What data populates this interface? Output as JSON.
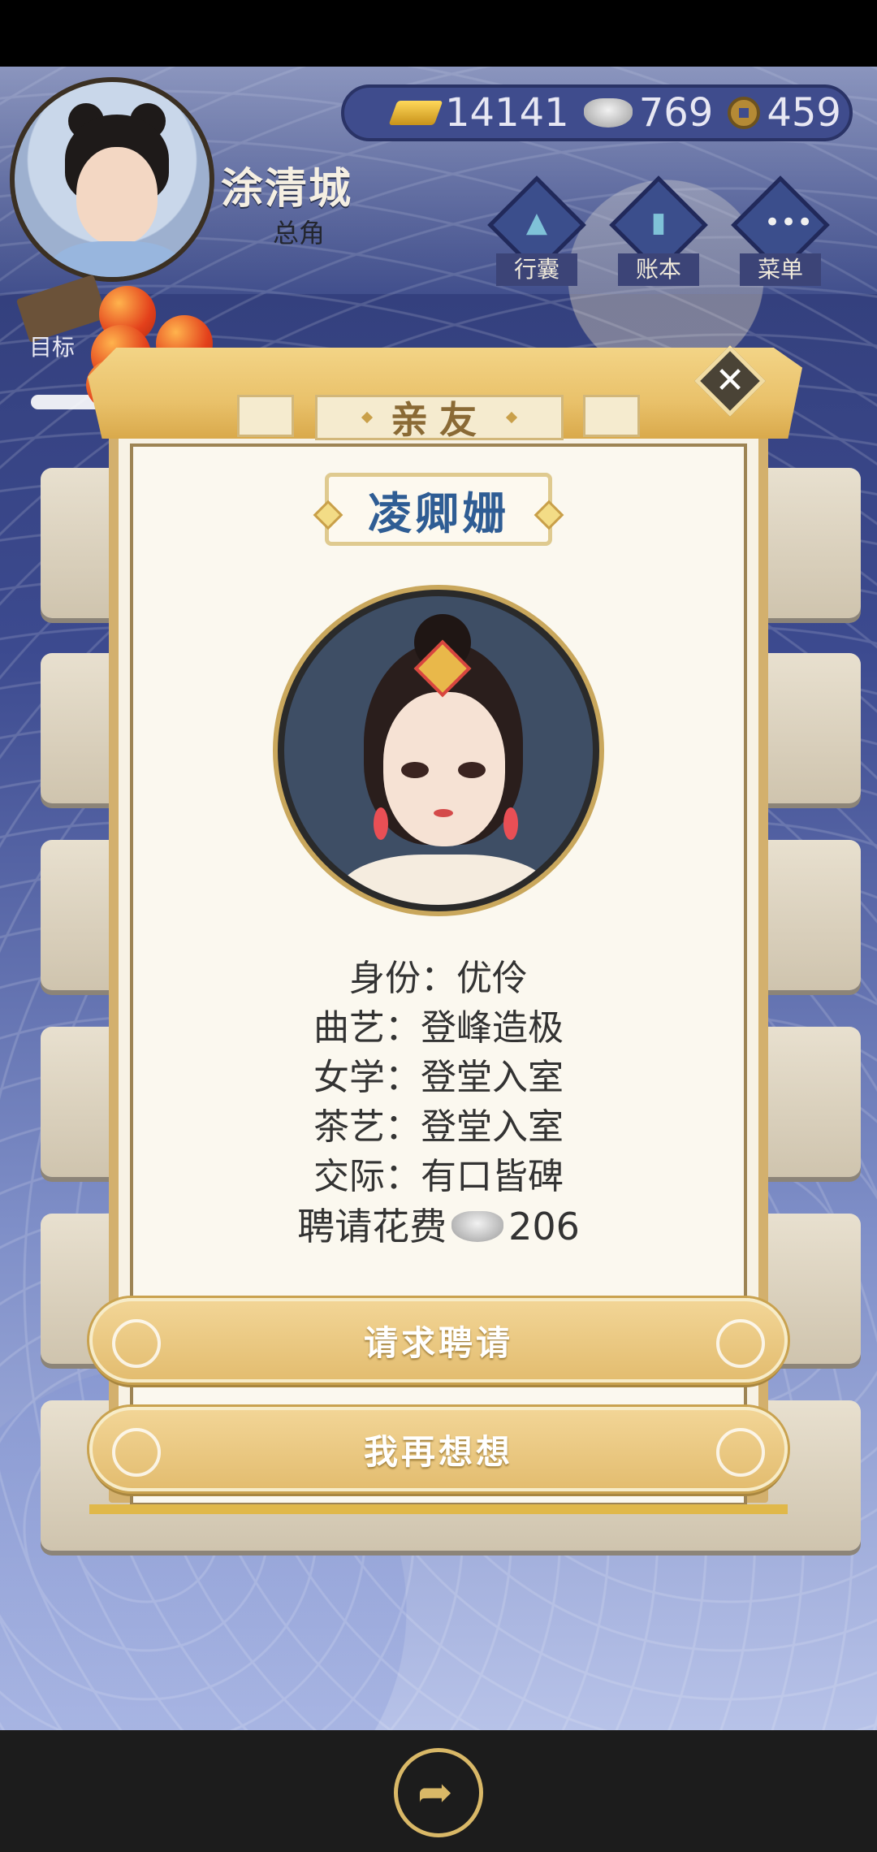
{
  "player": {
    "name": "涂清城",
    "role": "总角"
  },
  "currency": {
    "gold": "14141",
    "silver": "769",
    "coin": "459"
  },
  "menu": [
    {
      "label": "行囊",
      "icon": "bag-icon"
    },
    {
      "label": "账本",
      "icon": "ledger-icon"
    },
    {
      "label": "菜单",
      "icon": "menu-dots-icon"
    }
  ],
  "goal": {
    "label": "目标"
  },
  "modal": {
    "title": "亲友",
    "npc_name": "凌卿姗",
    "stats": [
      {
        "label": "身份：",
        "value": "优伶"
      },
      {
        "label": "曲艺：",
        "value": "登峰造极"
      },
      {
        "label": "女学：",
        "value": "登堂入室"
      },
      {
        "label": "茶艺：",
        "value": "登堂入室"
      },
      {
        "label": "交际：",
        "value": "有口皆碑"
      }
    ],
    "fee_label": "聘请花费",
    "fee_value": "206",
    "confirm_label": "请求聘请",
    "cancel_label": "我再想想"
  },
  "colors": {
    "accent_gold": "#e3bd70",
    "name_blue": "#2f5d94",
    "bg_indigo": "#3c4a8f"
  }
}
